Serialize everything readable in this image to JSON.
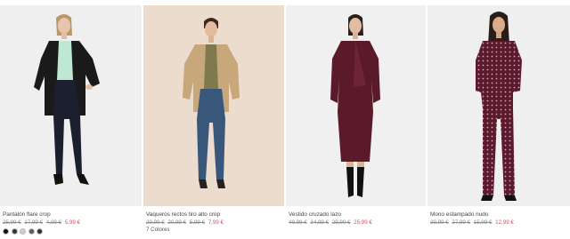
{
  "products": [
    {
      "name": "Pantalón flare crop",
      "old_prices": [
        "25,99 €",
        "17,99 €",
        "4,99 €"
      ],
      "sale_price": "5,99 €",
      "swatches": [
        "#111111",
        "#1f3d2c",
        "#cfcfcf",
        "#5c5c5c",
        "#2f2f38"
      ],
      "bg": "#efefef"
    },
    {
      "name": "Vaqueros rectos tiro alto crop",
      "old_prices": [
        "29,99 €",
        "20,99 €",
        "5,99 €"
      ],
      "sale_price": "7,99 €",
      "colors_label": "7 Colores",
      "bg": "#ebdcce"
    },
    {
      "name": "Vestido cruzado lazo",
      "old_prices": [
        "49,99 €",
        "34,99 €",
        "29,99 €"
      ],
      "sale_price": "25,99 €",
      "bg": "#f0f0f0"
    },
    {
      "name": "Mono estampado nudo",
      "old_prices": [
        "39,99 €",
        "27,99 €",
        "15,99 €"
      ],
      "sale_price": "12,99 €",
      "bg": "#efefef"
    }
  ]
}
